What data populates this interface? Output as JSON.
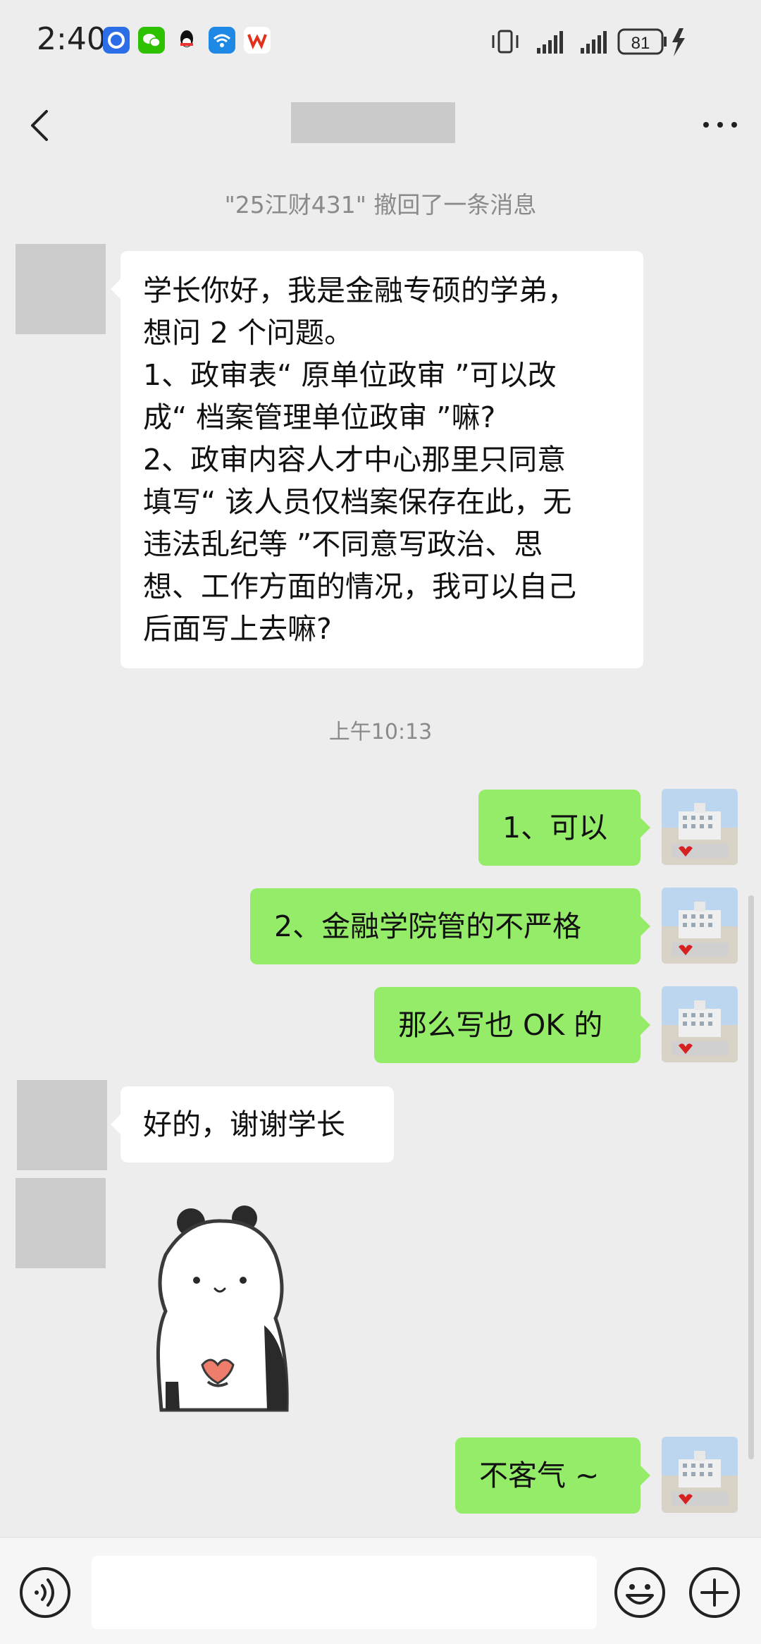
{
  "status_bar": {
    "time": "2:40",
    "battery": "81",
    "app_icons": [
      "baidu-netdisk-icon",
      "wechat-icon",
      "qq-icon",
      "wifi-master-icon",
      "wps-icon"
    ]
  },
  "nav": {
    "title": ""
  },
  "chat": {
    "recall_notice": "\"25江财431\" 撤回了一条消息",
    "timestamp": "上午10:13",
    "first_message": {
      "lines": [
        "学长你好，我是金融专硕的学弟，",
        "想问 2 个问题。",
        "1、政审表“ 原单位政审 ”可以改",
        "成“ 档案管理单位政审 ”嘛?",
        "2、政审内容人才中心那里只同意",
        "填写“ 该人员仅档案保存在此，无",
        "违法乱纪等 ”不同意写政治、思",
        "想、工作方面的情况，我可以自己",
        "后面写上去嘛?"
      ]
    },
    "reply_1": "1、可以",
    "reply_2": "2、金融学院管的不严格",
    "reply_3": "那么写也 OK 的",
    "thanks": "好的，谢谢学长",
    "final_reply": "不客气 ~"
  },
  "colors": {
    "background": "#ededed",
    "outgoing_bubble": "#95ec69",
    "incoming_bubble": "#ffffff"
  }
}
